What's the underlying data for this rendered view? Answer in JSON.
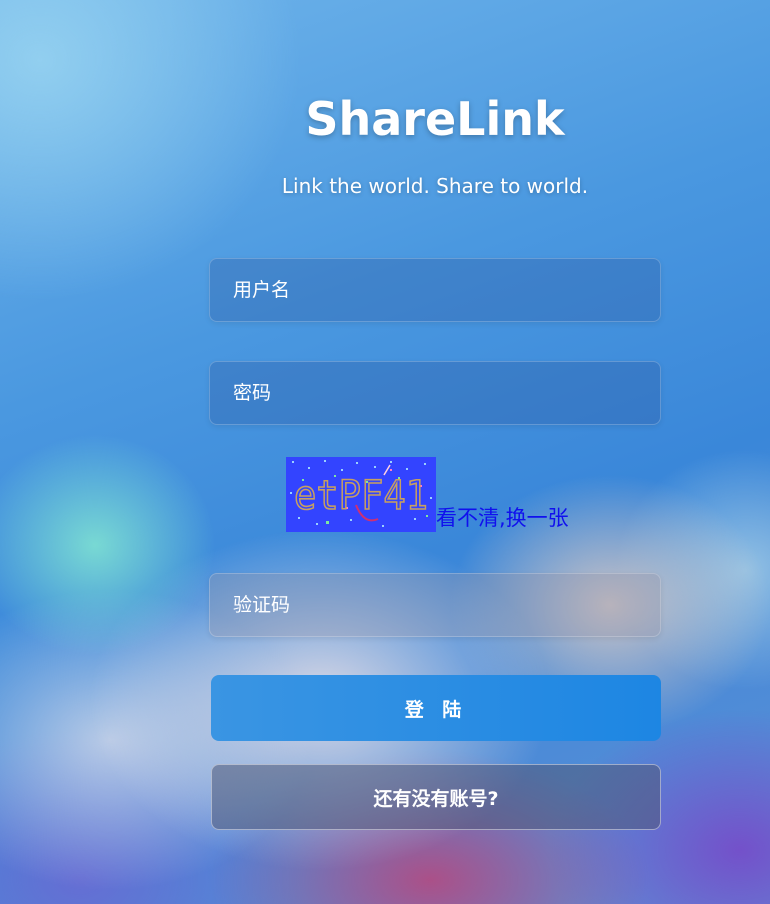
{
  "header": {
    "title": "ShareLink",
    "subtitle": "Link the world. Share to world."
  },
  "form": {
    "username_placeholder": "用户名",
    "password_placeholder": "密码",
    "captcha": {
      "text": "etPF41",
      "refresh_label": "看不清,换一张"
    },
    "captcha_placeholder": "验证码",
    "login_label": "登 陆",
    "register_label": "还有没有账号?"
  },
  "colors": {
    "login_button": "#2a8ee4",
    "refresh_link": "#1010ee",
    "captcha_background": "#3344ff",
    "captcha_text": "#c8a060"
  }
}
